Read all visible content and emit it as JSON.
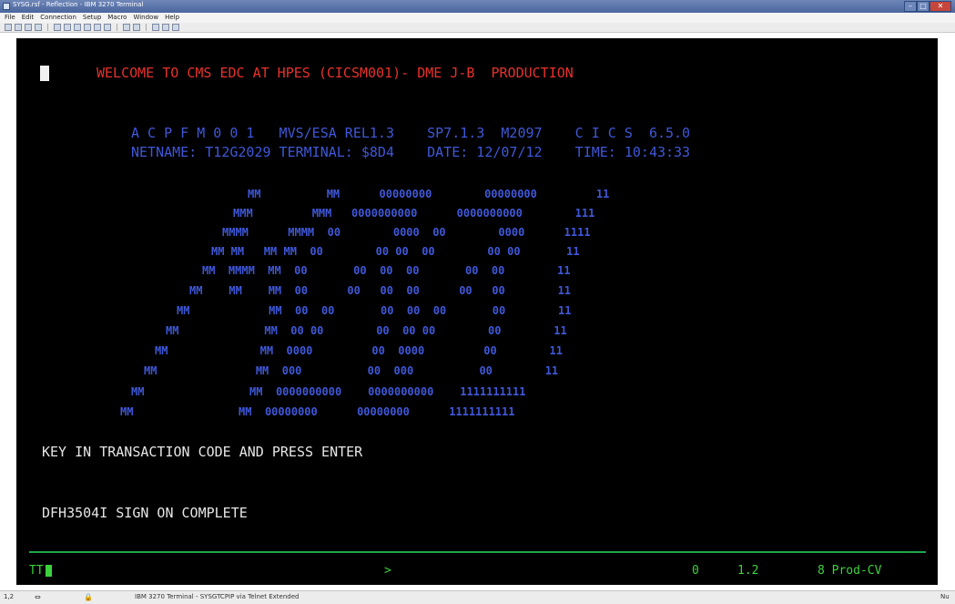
{
  "window": {
    "title": "SYSG.rsf - Reflection - IBM 3270 Terminal",
    "controls": {
      "minimize": "–",
      "maximize": "□",
      "close": "✕"
    }
  },
  "menubar": {
    "items": [
      "File",
      "Edit",
      "Connection",
      "Setup",
      "Macro",
      "Window",
      "Help"
    ]
  },
  "toolbar": {
    "icons": [
      "new-icon",
      "open-icon",
      "save-icon",
      "print-icon",
      "cut-icon",
      "copy-icon",
      "paste-icon",
      "transfer-icon",
      "settings-icon",
      "record-icon",
      "play-icon",
      "keyboard-icon",
      "display-icon",
      "network-icon",
      "help-icon"
    ]
  },
  "terminal": {
    "welcome": "WELCOME TO CMS EDC AT HPES (CICSM001)- DME J-B  PRODUCTION",
    "sysinfo_line1": "A C P F M 0 0 1   MVS/ESA REL1.3    SP7.1.3  M2097    C I C S  6.5.0",
    "sysinfo_line2": "NETNAME: T12G2029 TERMINAL: $8D4    DATE: 12/07/12    TIME: 10:43:33",
    "logo_lines": [
      "MM          MM      00000000        00000000         11",
      "MMM         MMM   0000000000      0000000000        111",
      "MMMM      MMMM  00        0000  00        0000      1111",
      "MM MM   MM MM  00        00 00  00        00 00       11",
      "MM  MMMM  MM  00       00  00  00       00  00        11",
      "MM    MM    MM  00      00   00  00      00   00        11",
      "MM            MM  00  00       00  00  00       00        11",
      "MM             MM  00 00        00  00 00        00        11",
      "MM              MM  0000         00  0000         00        11",
      "MM               MM  000          00  000          00        11",
      "MM                MM  0000000000    0000000000    1111111111",
      "MM                MM  00000000      00000000      1111111111"
    ],
    "prompt": "KEY IN TRANSACTION CODE AND PRESS ENTER",
    "message": "DFH3504I SIGN ON COMPLETE",
    "oia": {
      "left": "TT",
      "middle": ">",
      "col_a": "0",
      "col_b": "1.2",
      "col_c": "8 Prod-CV"
    }
  },
  "statusbar": {
    "position": "1,2",
    "session": "IBM 3270 Terminal - SYSGTCPIP via Telnet Extended",
    "right": "Nu"
  },
  "colors": {
    "screen_bg": "#000000",
    "welcome_red": "#e8312b",
    "info_blue": "#3f58d8",
    "text_white": "#e6e6e6",
    "oia_green": "#3cd23c"
  }
}
